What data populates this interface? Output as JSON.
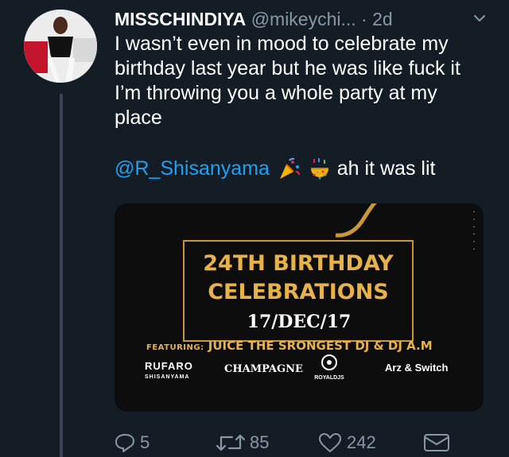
{
  "tweet": {
    "display_name": "MISSCHINDIYA",
    "handle": "@mikeychi...",
    "separator": " · ",
    "time": "2d",
    "text": "I wasn’t even in mood to celebrate my birthday last year but he was like fuck it I’m throwing you a whole party at my place",
    "mention": "@R_Shisanyama",
    "emojis": [
      "party-popper-icon",
      "confetti-ball-icon"
    ],
    "trailing_text": " ah it was lit"
  },
  "media": {
    "headline_line1": "24TH BIRTHDAY",
    "headline_line2": "CELEBRATIONS",
    "date": "17/DEC/17",
    "featuring_label": "FEATURING:",
    "featuring_text": " JUICE THE SRONGEST DJ & DJ A.M",
    "logos": [
      "RUFARO",
      "SHISANYAMA",
      "CHAMPAGNE",
      "ROYALDJS",
      "Arz",
      "Switch"
    ]
  },
  "actions": {
    "replies": "5",
    "retweets": "85",
    "likes": "242"
  },
  "colors": {
    "background": "#141d26",
    "link": "#1da1f2",
    "muted": "#8899a6",
    "gold": "#e7b24a"
  }
}
